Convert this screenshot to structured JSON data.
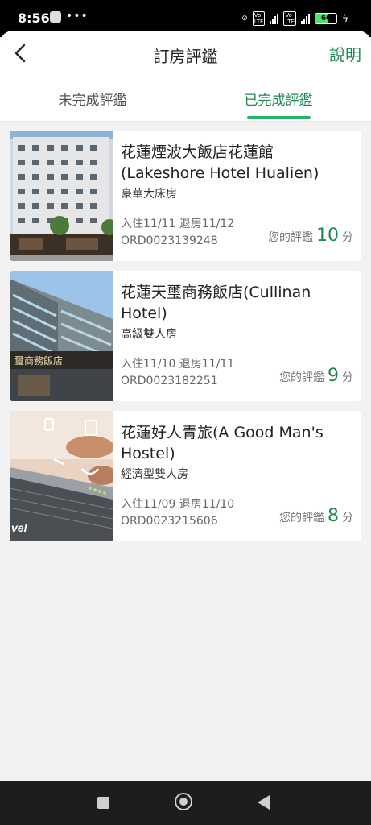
{
  "status_bar": {
    "time": "8:56",
    "battery": "60"
  },
  "header": {
    "title": "訂房評鑑",
    "help_label": "說明"
  },
  "tabs": [
    {
      "label": "未完成評鑑",
      "active": false
    },
    {
      "label": "已完成評鑑",
      "active": true
    }
  ],
  "reviews": [
    {
      "hotel_name": "花蓮煙波大飯店花蓮館(Lakeshore Hotel Hualien)",
      "room": "豪華大床房",
      "dates": "入住11/11   退房11/12",
      "order": "ORD0023139248",
      "score_label": "您的評鑑",
      "score": "10",
      "score_unit": "分"
    },
    {
      "hotel_name": "花蓮天璽商務飯店(Cullinan Hotel)",
      "room": "高級雙人房",
      "dates": "入住11/10   退房11/11",
      "order": "ORD0023182251",
      "score_label": "您的評鑑",
      "score": "9",
      "score_unit": "分"
    },
    {
      "hotel_name": "花蓮好人青旅(A Good Man's Hostel)",
      "room": "經濟型雙人房",
      "dates": "入住11/09   退房11/10",
      "order": "ORD0023215606",
      "score_label": "您的評鑑",
      "score": "8",
      "score_unit": "分"
    }
  ],
  "thumb_texts": {
    "sign2": "璽商務飯店",
    "logo3": "vel"
  },
  "colors": {
    "accent": "#1e8a4f",
    "tab_underline": "#1fb56b"
  }
}
